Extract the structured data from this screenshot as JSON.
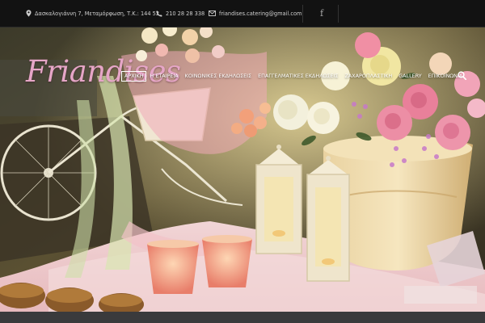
{
  "topbar": {
    "address": "Δασκαλογιάννη 7, Μεταμόρφωση, Τ.Κ.: 144 52",
    "phone": "210 28 28 338",
    "email": "friandises.catering@gmail.com",
    "social_icon": "f",
    "icons": [
      "location-pin-icon",
      "phone-icon",
      "envelope-icon",
      "facebook-icon"
    ]
  },
  "header": {
    "logo_text": "Friandises"
  },
  "nav": {
    "items": [
      {
        "label": "ΑΡΧΙΚΗ",
        "active": true
      },
      {
        "label": "Η ΕΤΑΙΡΕΙΑ",
        "active": false
      },
      {
        "label": "ΚΟΙΝΩΝΙΚΕΣ ΕΚΔΗΛΩΣΕΙΣ",
        "active": false
      },
      {
        "label": "ΕΠΑΓΓΕΛΜΑΤΙΚΕΣ ΕΚΔΗΛΩΣΕΙΣ",
        "active": false
      },
      {
        "label": "ΖΑΧΑΡΟΠΛΑΣΤΙΚΗ",
        "active": false
      },
      {
        "label": "GALLERY",
        "active": false
      },
      {
        "label": "ΕΠΙΚΟΙΝΩΝΙΑ",
        "active": false
      }
    ],
    "search_icon": "search-icon"
  },
  "hero": {
    "image": "decorated-bicycle-with-flowers-and-lanterns"
  },
  "colors": {
    "topbar_bg": "#121212",
    "topbar_text": "#cfcfcf",
    "logo": "#e6a6c7",
    "nav_text": "#ffffff",
    "bottombar_bg": "#3a3a3c"
  }
}
